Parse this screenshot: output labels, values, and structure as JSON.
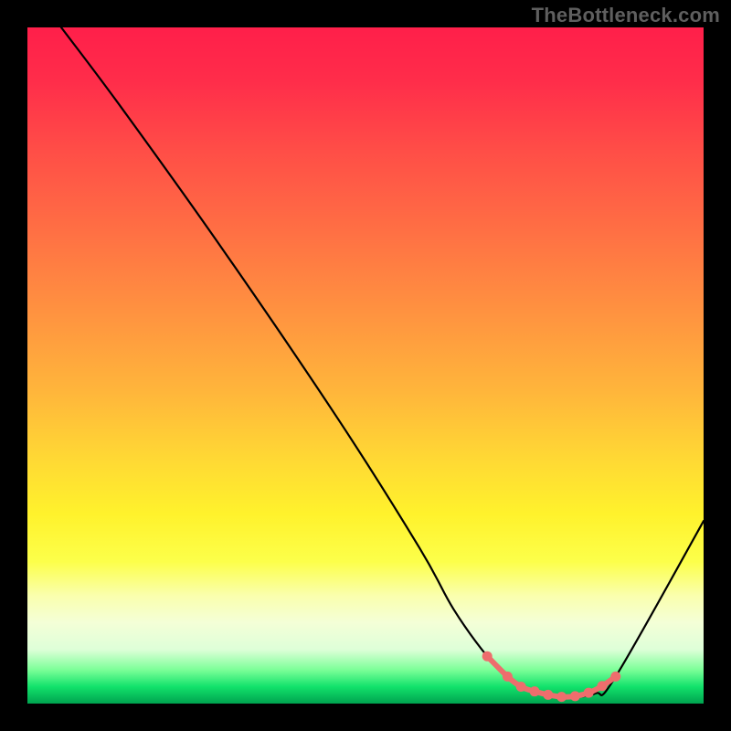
{
  "watermark": "TheBottleneck.com",
  "chart_data": {
    "type": "line",
    "title": "",
    "xlabel": "",
    "ylabel": "",
    "xlim": [
      0,
      100
    ],
    "ylim": [
      0,
      100
    ],
    "grid": false,
    "series": [
      {
        "name": "bottleneck-curve",
        "x": [
          5,
          14,
          29,
          46,
          58,
          63,
          68,
          72,
          76,
          80,
          84,
          87,
          100
        ],
        "values": [
          100,
          88,
          67,
          42,
          23,
          14,
          7,
          3,
          1.5,
          1,
          1.5,
          4,
          27
        ]
      }
    ],
    "highlight": {
      "name": "optimal-range",
      "x_from": 68,
      "x_to": 87,
      "dots_x": [
        68,
        71,
        73,
        75,
        77,
        79,
        81,
        83,
        85,
        87
      ],
      "dots_values": [
        7,
        4,
        2.5,
        1.8,
        1.3,
        1,
        1.1,
        1.6,
        2.6,
        4
      ]
    },
    "background_gradient": {
      "type": "vertical",
      "stops": [
        {
          "pos": 0.0,
          "color": "#ff1f4a"
        },
        {
          "pos": 0.3,
          "color": "#ff6f44"
        },
        {
          "pos": 0.55,
          "color": "#ffb63b"
        },
        {
          "pos": 0.72,
          "color": "#fff22c"
        },
        {
          "pos": 0.88,
          "color": "#f4ffd7"
        },
        {
          "pos": 0.97,
          "color": "#12e26b"
        },
        {
          "pos": 1.0,
          "color": "#00a34f"
        }
      ]
    }
  }
}
